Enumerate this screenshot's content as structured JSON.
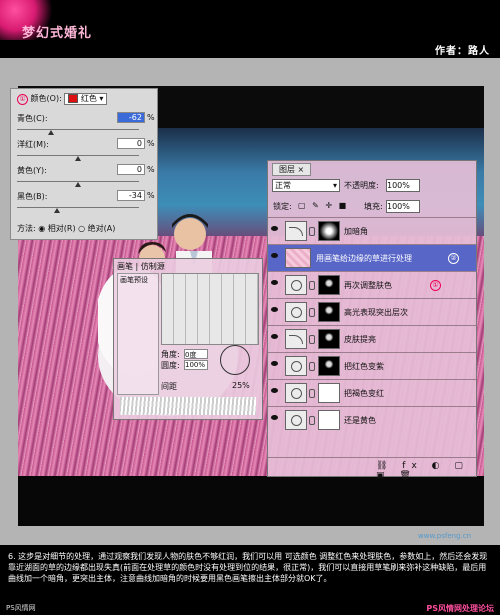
{
  "header": {
    "title": "梦幻式婚礼",
    "author": "作者：路人"
  },
  "hue_panel": {
    "badge": "①",
    "color_label": "颜色(O):",
    "color_value": "红色",
    "rows": [
      {
        "label": "青色(C):",
        "value": "-62",
        "pct": "%",
        "level": 0.28
      },
      {
        "label": "洋红(M):",
        "value": "0",
        "pct": "%",
        "level": 0.5
      },
      {
        "label": "黄色(Y):",
        "value": "0",
        "pct": "%",
        "level": 0.5
      },
      {
        "label": "黑色(B):",
        "value": "-34",
        "pct": "%",
        "level": 0.33
      }
    ],
    "method_label": "方法:",
    "method_relative": "相对(R)",
    "method_absolute": "绝对(A)"
  },
  "layers": {
    "tab": "图层 ×",
    "blend_mode": "正常",
    "opacity_label": "不透明度:",
    "opacity_value": "100%",
    "lock_label": "锁定:",
    "fill_label": "填充:",
    "fill_value": "100%",
    "items": [
      {
        "name": "加暗角",
        "active": false,
        "badge": ""
      },
      {
        "name": "用画笔给边缘的草进行处理",
        "active": true,
        "badge": "②"
      },
      {
        "name": "再次调整肤色",
        "active": false,
        "badge": "①"
      },
      {
        "name": "高光表现突出层次",
        "active": false,
        "badge": ""
      },
      {
        "name": "皮肤提亮",
        "active": false,
        "badge": ""
      },
      {
        "name": "把红色变紫",
        "active": false,
        "badge": ""
      },
      {
        "name": "把褐色变红",
        "active": false,
        "badge": ""
      },
      {
        "name": "还是黄色",
        "active": false,
        "badge": ""
      }
    ]
  },
  "brush_panel": {
    "tab1": "画笔",
    "tab2": "仿制源",
    "presets_label": "画笔预设",
    "angle_label": "角度:",
    "angle_value": "0度",
    "roundness_label": "圆度:",
    "roundness_value": "100%",
    "spacing_label": "间距",
    "spacing_value": "25%"
  },
  "caption": {
    "text": "6. 这步是对细节的处理，通过观察我们发现人物的肤色不够红润，我们可以用 可选颜色 调整红色来处理肤色，参数如上，然后还会发现靠近湖面的草的边缘都出现失真(前面在处理草的颜色时没有处理到位的结果，很正常)，我们可以直接用草笔刷来弥补这种缺陷，最后用曲线加一个暗角，更突出主体，注意曲线加暗角的时候要用黑色画笔擦出主体部分就OK了。",
    "footer_left": "PS风情网",
    "footer_right": "PS风情网处理论坛",
    "watermark": "www.psfeng.cn"
  },
  "colors": {
    "accent_pink": "#ff4f9d",
    "layer_active": "#5866c8"
  }
}
